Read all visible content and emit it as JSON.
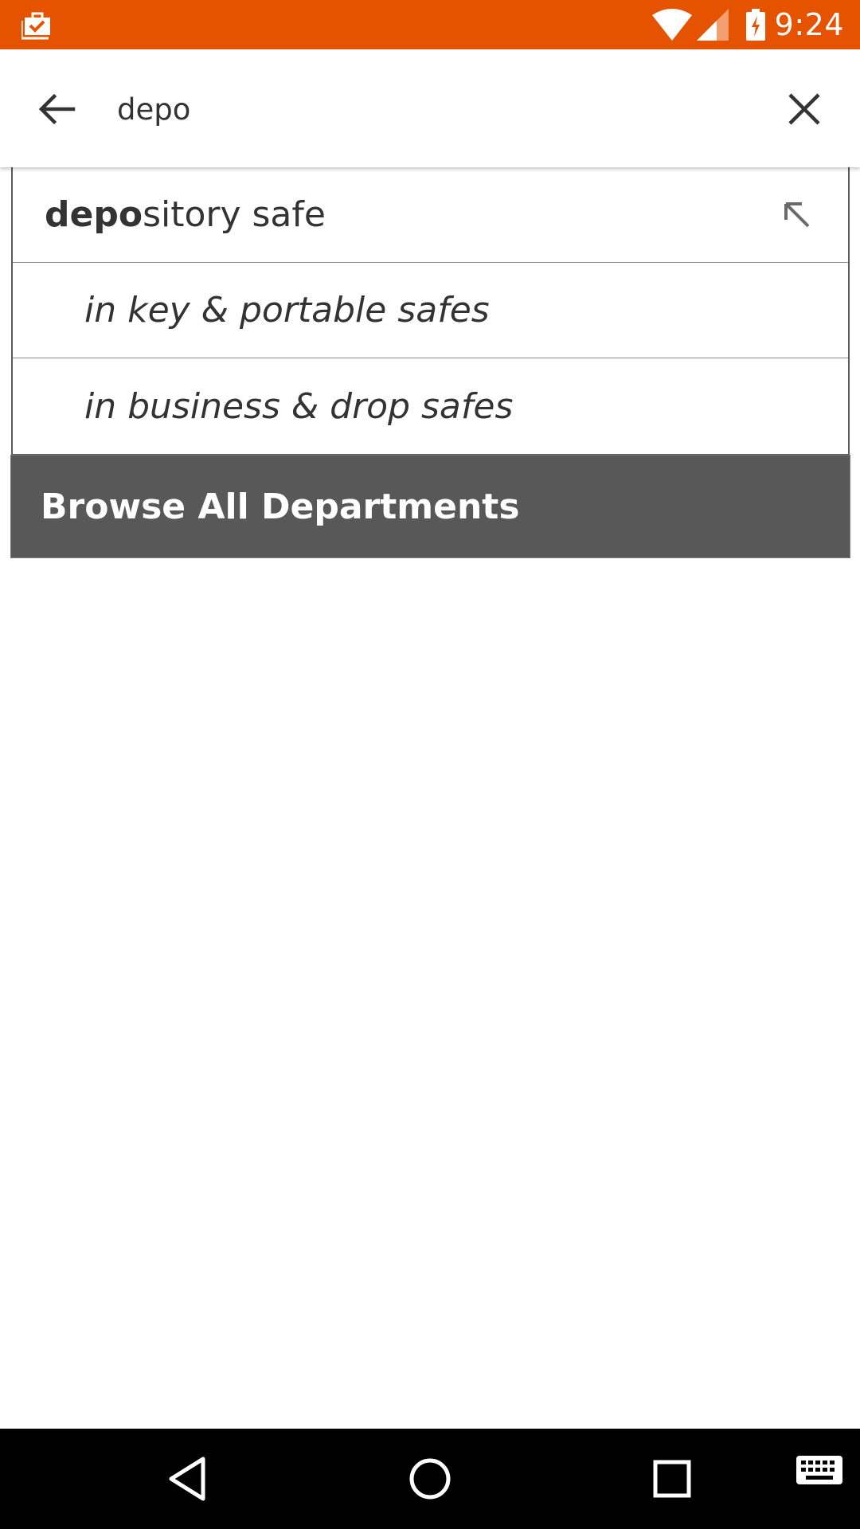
{
  "status_bar": {
    "notification_icon": "briefcase-check-icon",
    "wifi_icon": "wifi-icon",
    "signal_icon": "cell-signal-icon",
    "battery_icon": "battery-charging-icon",
    "time": "9:24",
    "color": "#e65300"
  },
  "search": {
    "back_icon": "arrow-back-icon",
    "query": "depo",
    "clear_icon": "close-icon"
  },
  "suggestions": [
    {
      "match": "depo",
      "rest": "sitory safe",
      "icon": "arrow-up-left-icon"
    },
    {
      "label": "in key & portable safes"
    },
    {
      "label": "in business & drop safes"
    }
  ],
  "browse_all": {
    "label": "Browse All Departments",
    "color": "#585858"
  },
  "nav_bar": {
    "back_icon": "nav-back-icon",
    "home_icon": "nav-home-icon",
    "recents_icon": "nav-recents-icon",
    "keyboard_icon": "keyboard-icon"
  }
}
